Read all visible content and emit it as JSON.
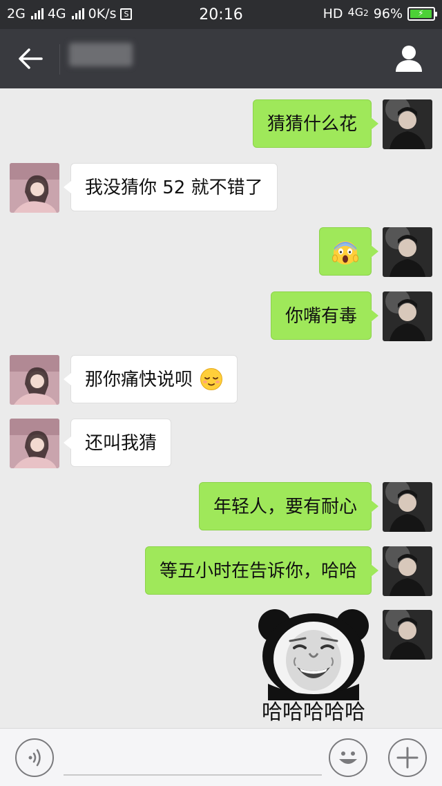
{
  "status_bar": {
    "network_1": "2G",
    "network_2": "4G",
    "speed": "0K/s",
    "s_icon": "S",
    "time": "20:16",
    "hd": "HD",
    "network_3": "4G",
    "network_3_sub": "2",
    "battery_percent": "96%",
    "battery_level": 0.96
  },
  "nav": {
    "icons": {
      "back": "arrow-left",
      "profile": "person"
    }
  },
  "messages": [
    {
      "side": "out",
      "text": "猜猜什么花"
    },
    {
      "side": "in",
      "text": "我没猜你 52 就不错了"
    },
    {
      "side": "out",
      "text": "",
      "emoji": "face-screaming-in-fear"
    },
    {
      "side": "out",
      "text": "你嘴有毒"
    },
    {
      "side": "in",
      "text": "那你痛快说呗",
      "emoji": "relieved-face"
    },
    {
      "side": "in",
      "text": "还叫我猜"
    },
    {
      "side": "out",
      "text": "年轻人，要有耐心"
    },
    {
      "side": "out",
      "text": "等五小时在告诉你，哈哈"
    },
    {
      "side": "out",
      "sticker": "panda-face-laughing",
      "caption": "哈哈哈哈哈"
    }
  ],
  "input_bar": {
    "value": "",
    "icons": {
      "voice": "voice-waves",
      "emoji": "smiley-face",
      "more": "plus"
    }
  },
  "colors": {
    "status_bar_bg": "#2d2e31",
    "nav_bg": "#393a3f",
    "chat_bg": "#ebebeb",
    "outgoing_bubble": "#9fe85a",
    "incoming_bubble": "#ffffff",
    "battery_fill": "#4cd137"
  }
}
